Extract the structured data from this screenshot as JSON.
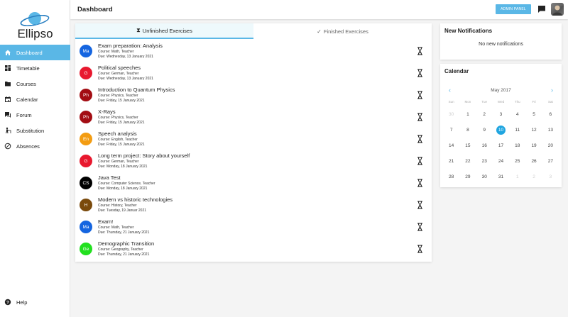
{
  "app": {
    "name": "Ellipso"
  },
  "sidebar": {
    "items": [
      {
        "label": "Dashboard",
        "icon": "home-icon"
      },
      {
        "label": "Timetable",
        "icon": "timetable-icon"
      },
      {
        "label": "Courses",
        "icon": "folder-icon"
      },
      {
        "label": "Calendar",
        "icon": "calendar-icon"
      },
      {
        "label": "Forum",
        "icon": "forum-icon"
      },
      {
        "label": "Substitution",
        "icon": "substitution-icon"
      },
      {
        "label": "Absences",
        "icon": "absence-icon"
      }
    ],
    "help": {
      "label": "Help",
      "icon": "help-icon"
    }
  },
  "header": {
    "title": "Dashboard",
    "admin_label": "ADMIN PANEL"
  },
  "tabs": {
    "unfinished": "Unfinished Exercises",
    "finished": "Finished Exercises"
  },
  "exercises": [
    {
      "initials": "Ma",
      "color": "#1565e0",
      "title": "Exam preparation: Analysis",
      "course": "Course: Math, Teacher",
      "due": "Due: Wednesday, 13 January 2021"
    },
    {
      "initials": "G",
      "color": "#e8182e",
      "title": "Political speeches",
      "course": "Course: German, Teacher",
      "due": "Due: Wednesday, 13 January 2021"
    },
    {
      "initials": "Ph",
      "color": "#a30d13",
      "title": "Introduction to Quantum Physics",
      "course": "Course: Physics, Teacher",
      "due": "Due: Friday, 15 January 2021"
    },
    {
      "initials": "Ph",
      "color": "#a30d13",
      "title": "X-Rays",
      "course": "Course: Physics, Teacher",
      "due": "Due: Friday, 15 January 2021"
    },
    {
      "initials": "En",
      "color": "#f39c12",
      "title": "Speech analysis",
      "course": "Course: English, Teacher",
      "due": "Due: Friday, 15 January 2021"
    },
    {
      "initials": "G",
      "color": "#e8182e",
      "title": "Long term project: Story about yourself",
      "course": "Course: German, Teacher",
      "due": "Due: Monday, 18 January 2021"
    },
    {
      "initials": "CS",
      "color": "#000000",
      "title": "Java Test",
      "course": "Course: Computer Science, Teacher",
      "due": "Due: Monday, 18 January 2021"
    },
    {
      "initials": "H",
      "color": "#7a4a0c",
      "title": "Modern vs historic technologies",
      "course": "Course: History, Teacher",
      "due": "Due: Tuesday, 19 Januar 2021"
    },
    {
      "initials": "Ma",
      "color": "#1565e0",
      "title": "Exam!",
      "course": "Course: Math, Teacher",
      "due": "Due: Thursday, 21 January 2021"
    },
    {
      "initials": "Ge",
      "color": "#22e01f",
      "title": "Demographic Transition",
      "course": "Course: Geography, Teacher",
      "due": "Due: Thursday, 21 January 2021"
    }
  ],
  "notifications": {
    "title": "New Notifications",
    "empty": "No new notifications"
  },
  "calendar": {
    "title": "Calendar",
    "month": "May 2017",
    "prev": "‹",
    "next": "›",
    "weekdays": [
      "Sun",
      "Mon",
      "Tue",
      "Wed",
      "Thu",
      "Fri",
      "Sat"
    ],
    "weeks": [
      [
        "30",
        "1",
        "2",
        "3",
        "4",
        "5",
        "6"
      ],
      [
        "7",
        "8",
        "9",
        "10",
        "11",
        "12",
        "13"
      ],
      [
        "14",
        "15",
        "16",
        "17",
        "18",
        "19",
        "20"
      ],
      [
        "21",
        "22",
        "23",
        "24",
        "25",
        "26",
        "27"
      ],
      [
        "28",
        "29",
        "30",
        "31",
        "1",
        "2",
        "3"
      ]
    ],
    "muted": [
      [
        0,
        0
      ],
      [
        4,
        4
      ],
      [
        4,
        5
      ],
      [
        4,
        6
      ]
    ],
    "today": [
      1,
      3
    ]
  }
}
